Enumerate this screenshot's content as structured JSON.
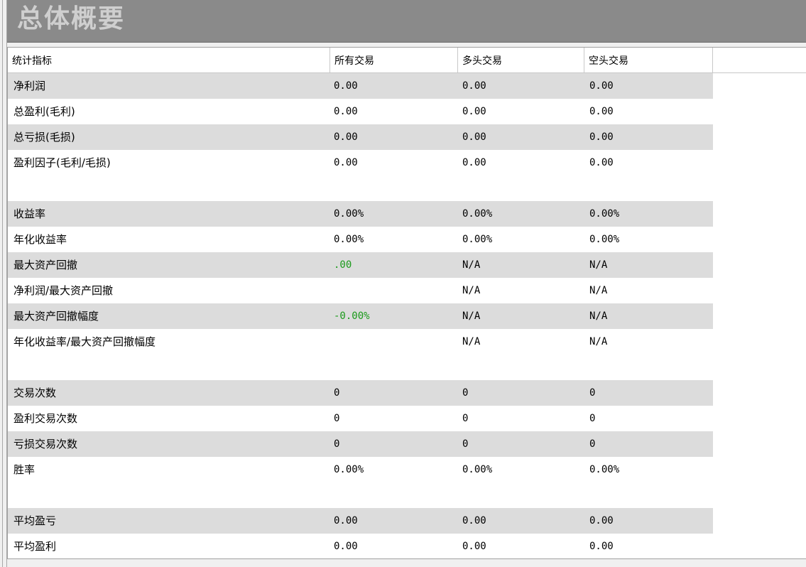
{
  "window": {
    "title": "总体概要"
  },
  "table": {
    "headers": [
      "统计指标",
      "所有交易",
      "多头交易",
      "空头交易"
    ],
    "rows": [
      {
        "label": "净利润",
        "all": "0.00",
        "long": "0.00",
        "short": "0.00",
        "shade": true
      },
      {
        "label": "总盈利(毛利)",
        "all": "0.00",
        "long": "0.00",
        "short": "0.00",
        "shade": false
      },
      {
        "label": "总亏损(毛损)",
        "all": "0.00",
        "long": "0.00",
        "short": "0.00",
        "shade": true
      },
      {
        "label": "盈利因子(毛利/毛损)",
        "all": "0.00",
        "long": "0.00",
        "short": "0.00",
        "shade": false
      },
      {
        "label": "",
        "all": "",
        "long": "",
        "short": "",
        "shade": false
      },
      {
        "label": "收益率",
        "all": "0.00%",
        "long": "0.00%",
        "short": "0.00%",
        "shade": true
      },
      {
        "label": "年化收益率",
        "all": "0.00%",
        "long": "0.00%",
        "short": "0.00%",
        "shade": false
      },
      {
        "label": "最大资产回撤",
        "all": ".00",
        "long": "N/A",
        "short": "N/A",
        "shade": true,
        "all_color": "green"
      },
      {
        "label": "净利润/最大资产回撤",
        "all": "",
        "long": "N/A",
        "short": "N/A",
        "shade": false
      },
      {
        "label": "最大资产回撤幅度",
        "all": "-0.00%",
        "long": "N/A",
        "short": "N/A",
        "shade": true,
        "all_color": "green"
      },
      {
        "label": "年化收益率/最大资产回撤幅度",
        "all": "",
        "long": "N/A",
        "short": "N/A",
        "shade": false
      },
      {
        "label": "",
        "all": "",
        "long": "",
        "short": "",
        "shade": false
      },
      {
        "label": "交易次数",
        "all": "0",
        "long": "0",
        "short": "0",
        "shade": true
      },
      {
        "label": "盈利交易次数",
        "all": "0",
        "long": "0",
        "short": "0",
        "shade": false
      },
      {
        "label": "亏损交易次数",
        "all": "0",
        "long": "0",
        "short": "0",
        "shade": true
      },
      {
        "label": "胜率",
        "all": "0.00%",
        "long": "0.00%",
        "short": "0.00%",
        "shade": false
      },
      {
        "label": "",
        "all": "",
        "long": "",
        "short": "",
        "shade": false
      },
      {
        "label": "平均盈亏",
        "all": "0.00",
        "long": "0.00",
        "short": "0.00",
        "shade": true
      },
      {
        "label": "平均盈利",
        "all": "0.00",
        "long": "0.00",
        "short": "0.00",
        "shade": false
      }
    ]
  },
  "colors": {
    "shade_row": "#dcdcdc",
    "title_bar": "#8a8a8a",
    "green_value": "#1a9a1a"
  }
}
